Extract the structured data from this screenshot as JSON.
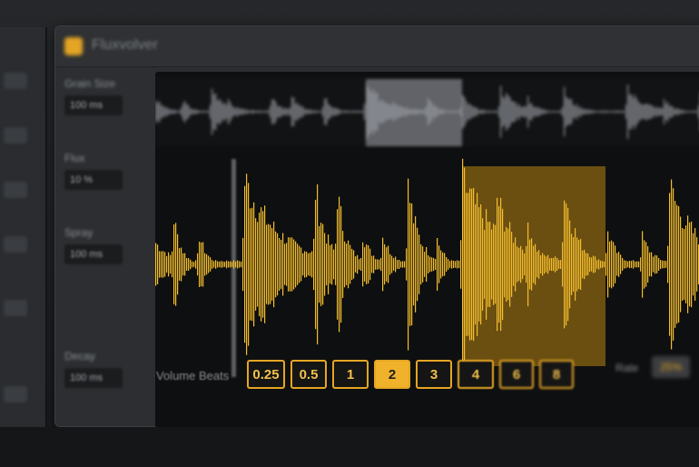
{
  "device": {
    "title": "Fluxvolver"
  },
  "params": [
    {
      "label": "Grain Size",
      "value": "100 ms"
    },
    {
      "label": "Flux",
      "value": "10 %"
    },
    {
      "label": "Spray",
      "value": "100 ms"
    },
    {
      "label": "Decay",
      "value": "100 ms"
    }
  ],
  "beats": {
    "label": "Volume Beats",
    "options": [
      "0.25",
      "0.5",
      "1",
      "2",
      "3",
      "4",
      "6",
      "8"
    ],
    "selected": "2"
  },
  "rate": {
    "label": "Rate",
    "value": "25%"
  },
  "colors": {
    "accent": "#f0b22b",
    "waveform_overview": "#8c8f95",
    "display_bg": "#0e0f10"
  }
}
